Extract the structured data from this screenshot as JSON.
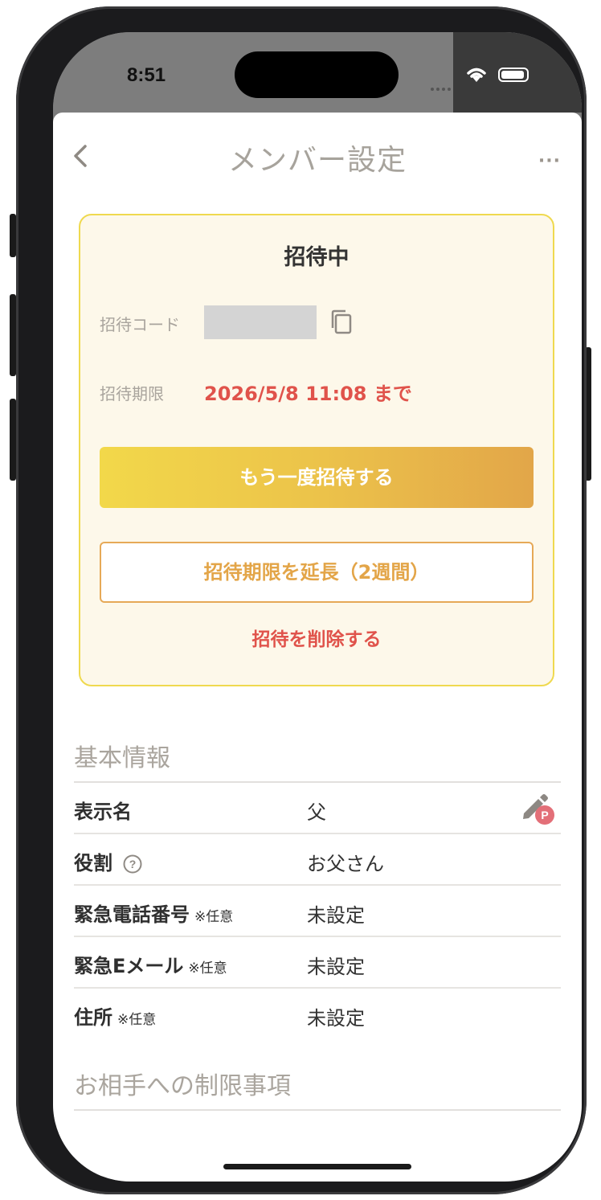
{
  "status_bar": {
    "time": "8:51"
  },
  "header": {
    "title": "メンバー設定",
    "more": "···"
  },
  "invite_card": {
    "title": "招待中",
    "code_label": "招待コード",
    "expiry_label": "招待期限",
    "expiry_value": "2026/5/8 11:08 まで",
    "reinvite_button": "もう一度招待する",
    "extend_button": "招待期限を延長（2週間）",
    "delete_link": "招待を削除する"
  },
  "basic_info": {
    "title": "基本情報",
    "rows": [
      {
        "label": "表示名",
        "optional": "",
        "value": "父"
      },
      {
        "label": "役割",
        "optional": "",
        "value": "お父さん"
      },
      {
        "label": "緊急電話番号",
        "optional": "※任意",
        "value": "未設定"
      },
      {
        "label": "緊急Eメール",
        "optional": "※任意",
        "value": "未設定"
      },
      {
        "label": "住所",
        "optional": "※任意",
        "value": "未設定"
      }
    ]
  },
  "restrictions": {
    "title": "お相手への制限事項"
  },
  "colors": {
    "accent": "#e3a548",
    "danger": "#e0534b",
    "card_border": "#efd94f"
  },
  "icons": [
    "back-chevron-icon",
    "more-icon",
    "copy-icon",
    "help-icon",
    "edit-pencil-icon",
    "wifi-icon",
    "battery-icon"
  ]
}
